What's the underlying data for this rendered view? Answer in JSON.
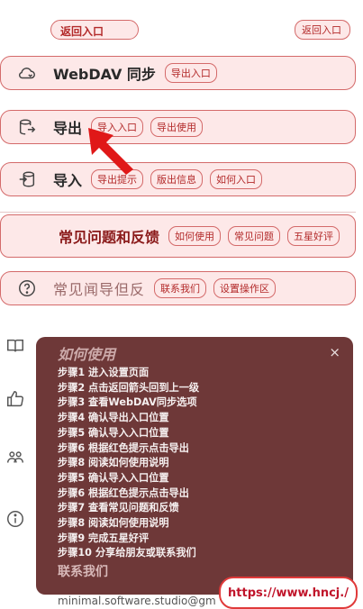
{
  "top_bar": {
    "back_left": "返回入口",
    "back_right": "返回入口"
  },
  "rows": [
    {
      "icon": "cloud-sync-icon",
      "title": "WebDAV 同步",
      "pills": [
        "导出入口"
      ]
    },
    {
      "icon": "export-icon",
      "title": "导出",
      "pills": [
        "导入入口",
        "导出使用"
      ]
    },
    {
      "icon": "import-icon",
      "title": "导入",
      "pills": [
        "导出提示",
        "版出信息",
        "如何入口"
      ]
    },
    {
      "icon": "",
      "title": "常见问题和反馈",
      "pills": [
        "如何使用",
        "常见问题",
        "五星好评"
      ]
    },
    {
      "icon": "help-icon",
      "title": "常见闻导但反",
      "pills": [
        "联系我们",
        "设置操作区"
      ]
    }
  ],
  "panel": {
    "heading": "如何使用",
    "close": "×",
    "steps": [
      "步骤1 进入设置页面",
      "步骤2 点击返回箭头回到上一级",
      "步骤3 查看WebDAV同步选项",
      "步骤4 确认导出入口位置",
      "步骤5 确认导入入口位置",
      "步骤6 根据红色提示点击导出",
      "步骤8 阅读如何使用说明",
      "步骤5 确认导入入口位置",
      "步骤6 根据红色提示点击导出",
      "步骤7 查看常见问题和反馈",
      "步骤8 阅读如何使用说明",
      "步骤9 完成五星好评",
      "步骤10 分享给朋友或联系我们"
    ],
    "footer": "联系我们"
  },
  "email": "minimal.software.studio@gm",
  "url_button": "https://www.hncj./",
  "side_icons": [
    "book-icon",
    "thumbs-up-icon",
    "people-icon",
    "info-icon"
  ],
  "colors": {
    "accent": "#d46a6a",
    "pill_bg": "#fde8e8",
    "panel_bg": "#6e3838",
    "arrow": "#e01818"
  }
}
